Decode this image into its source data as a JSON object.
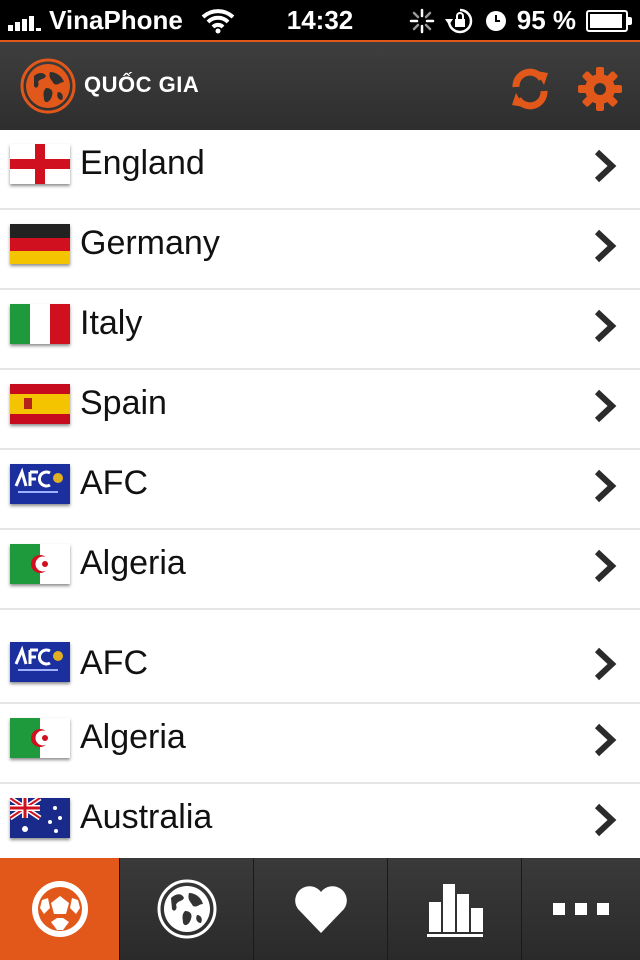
{
  "status_bar": {
    "carrier": "VinaPhone",
    "time": "14:32",
    "battery": "95 %",
    "battery_level": 0.95,
    "icons": [
      "signal-icon",
      "wifi-icon",
      "activity-spinner-icon",
      "rotation-lock-icon",
      "alarm-icon",
      "battery-icon"
    ]
  },
  "header": {
    "title": "QUỐC GIA",
    "logo_icon": "globe-icon",
    "actions": [
      "refresh-icon",
      "gear-icon"
    ],
    "accent_color": "#e2581a"
  },
  "countries": [
    {
      "name": "England",
      "flag": "england-flag-icon"
    },
    {
      "name": "Germany",
      "flag": "germany-flag-icon"
    },
    {
      "name": "Italy",
      "flag": "italy-flag-icon"
    },
    {
      "name": "Spain",
      "flag": "spain-flag-icon"
    },
    {
      "name": "AFC",
      "flag": "afc-logo-icon"
    },
    {
      "name": "Algeria",
      "flag": "algeria-flag-icon"
    },
    {
      "name": "AFC",
      "flag": "afc-logo-icon"
    },
    {
      "name": "Algeria",
      "flag": "algeria-flag-icon"
    },
    {
      "name": "Australia",
      "flag": "australia-flag-icon"
    }
  ],
  "tab_bar": {
    "active_index": 0,
    "tabs": [
      "soccer-ball-icon",
      "globe-icon",
      "heart-icon",
      "bar-chart-icon",
      "more-icon"
    ]
  }
}
